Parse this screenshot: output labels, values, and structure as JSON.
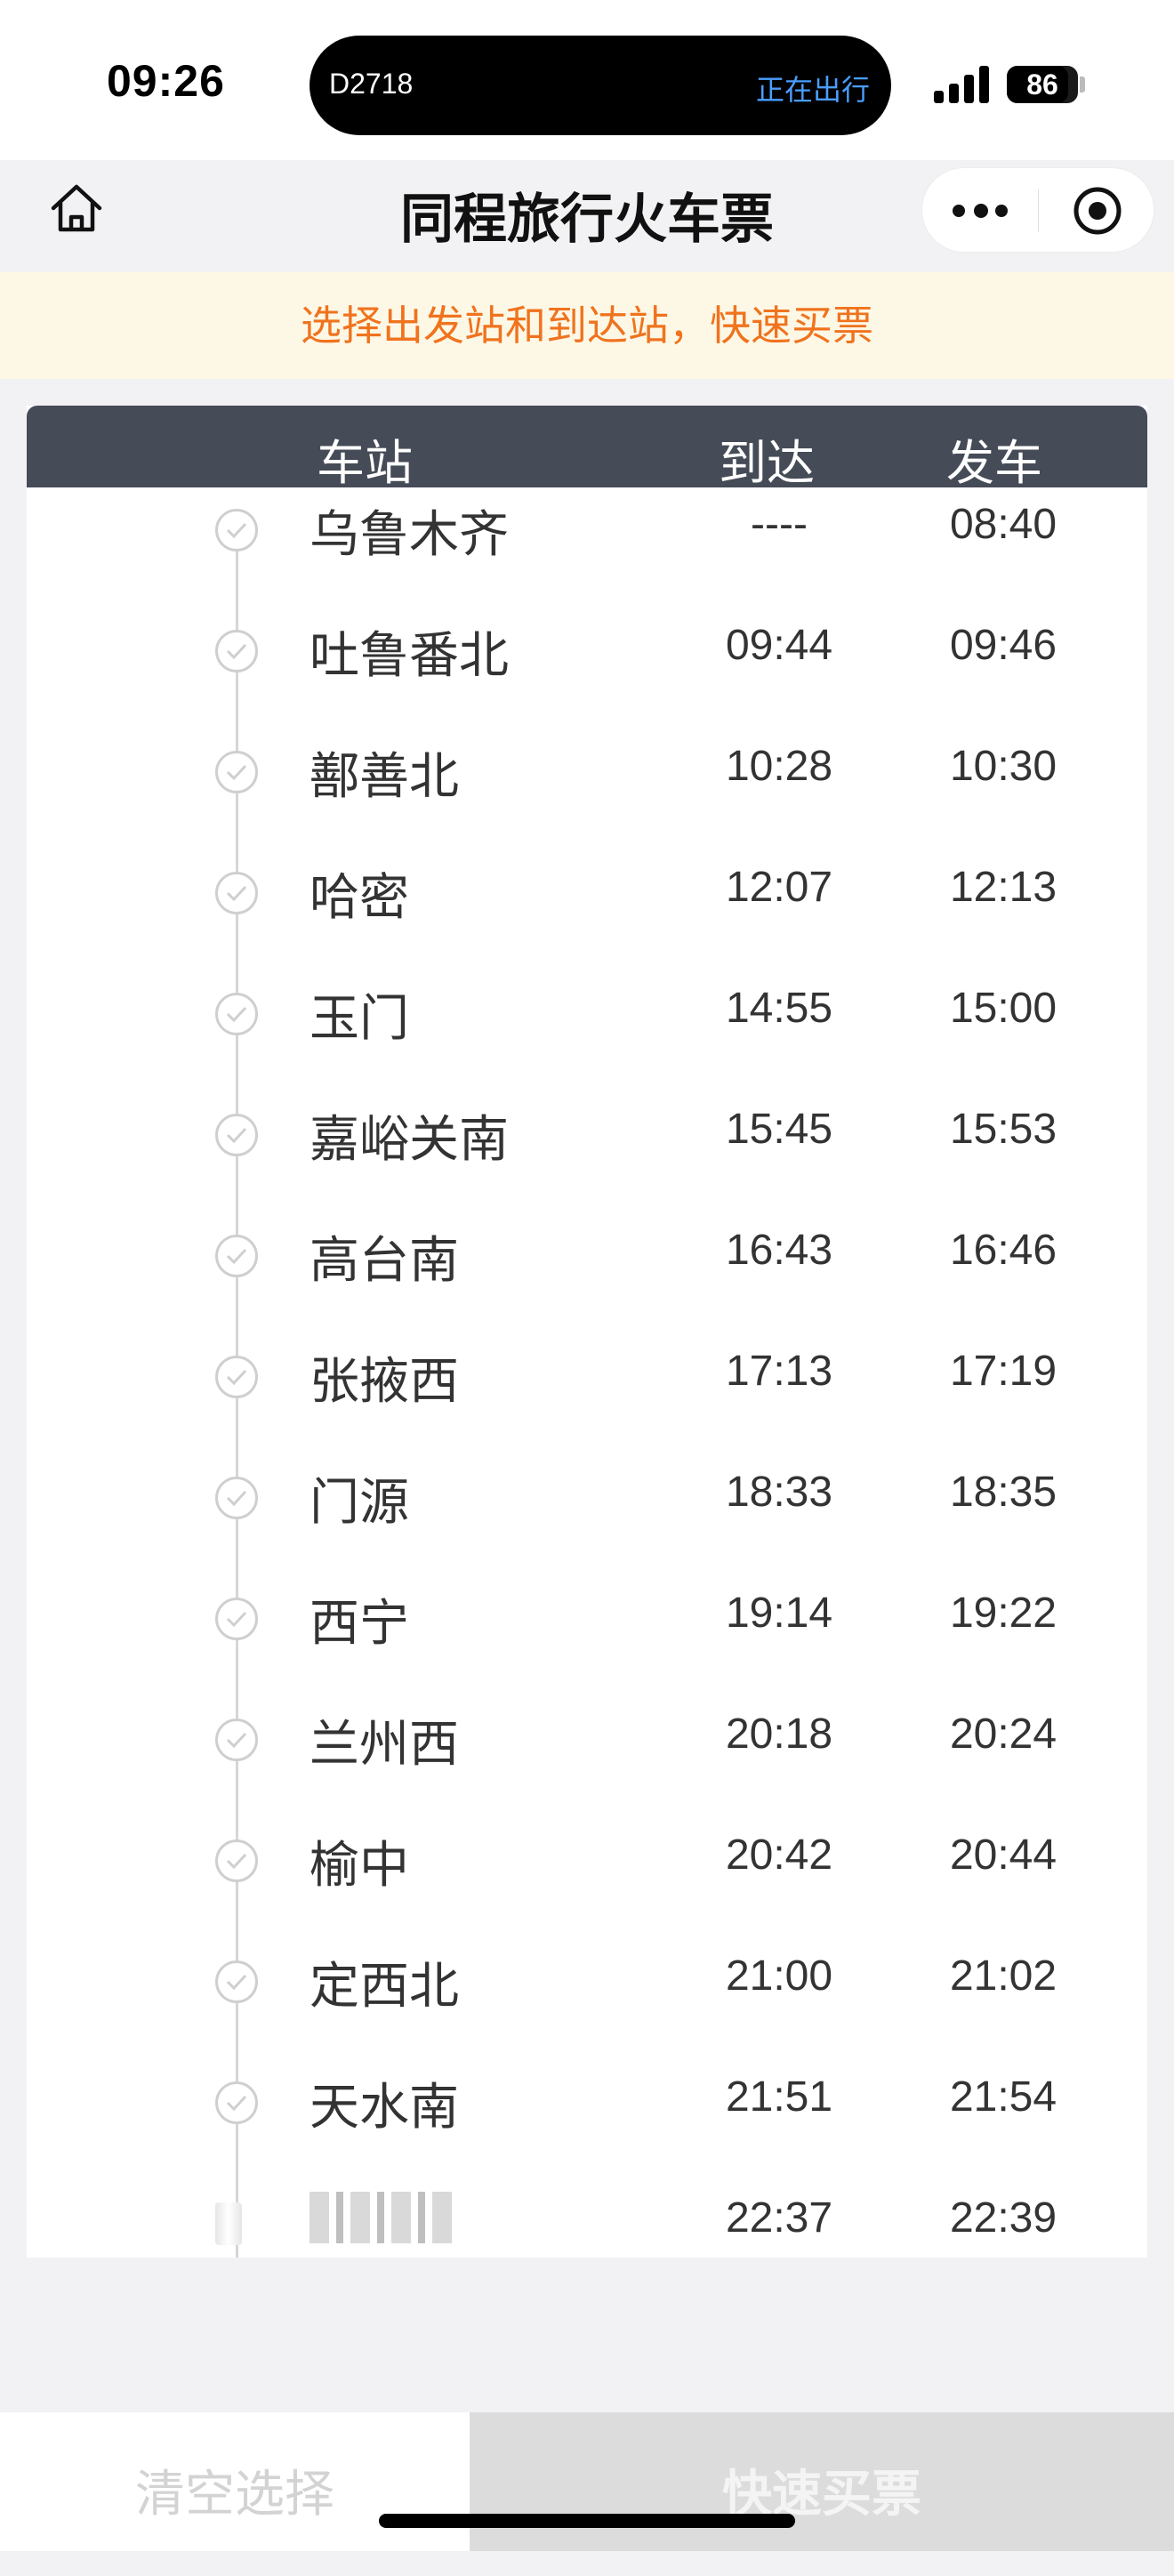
{
  "status_bar": {
    "time": "09:26",
    "island_train": "D2718",
    "island_status": "正在出行",
    "battery": "86"
  },
  "header": {
    "title": "同程旅行火车票",
    "icons": [
      "home-icon",
      "more-icon",
      "close-miniprogram-icon"
    ]
  },
  "notice": "选择出发站和到达站，快速买票",
  "table": {
    "headers": {
      "station": "车站",
      "arrive": "到达",
      "depart": "发车"
    },
    "rows": [
      {
        "station": "乌鲁木齐",
        "arrive": "----",
        "depart": "08:40"
      },
      {
        "station": "吐鲁番北",
        "arrive": "09:44",
        "depart": "09:46"
      },
      {
        "station": "鄯善北",
        "arrive": "10:28",
        "depart": "10:30"
      },
      {
        "station": "哈密",
        "arrive": "12:07",
        "depart": "12:13"
      },
      {
        "station": "玉门",
        "arrive": "14:55",
        "depart": "15:00"
      },
      {
        "station": "嘉峪关南",
        "arrive": "15:45",
        "depart": "15:53"
      },
      {
        "station": "高台南",
        "arrive": "16:43",
        "depart": "16:46"
      },
      {
        "station": "张掖西",
        "arrive": "17:13",
        "depart": "17:19"
      },
      {
        "station": "门源",
        "arrive": "18:33",
        "depart": "18:35"
      },
      {
        "station": "西宁",
        "arrive": "19:14",
        "depart": "19:22"
      },
      {
        "station": "兰州西",
        "arrive": "20:18",
        "depart": "20:24"
      },
      {
        "station": "榆中",
        "arrive": "20:42",
        "depart": "20:44"
      },
      {
        "station": "定西北",
        "arrive": "21:00",
        "depart": "21:02"
      },
      {
        "station": "天水南",
        "arrive": "21:51",
        "depart": "21:54"
      },
      {
        "station": "",
        "arrive": "22:37",
        "depart": "22:39"
      }
    ]
  },
  "bottom": {
    "clear_label": "清空选择",
    "buy_label": "快速买票"
  },
  "colors": {
    "accent_orange": "#f0731e",
    "header_dark": "#454b57",
    "notice_bg": "#fdf8e6"
  }
}
